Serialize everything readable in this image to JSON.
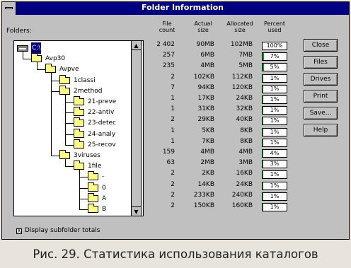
{
  "window": {
    "title": "Folder Information"
  },
  "folders_label": "Folders:",
  "columns": {
    "file_count": [
      "File",
      "count"
    ],
    "actual_size": [
      "Actual",
      "size"
    ],
    "allocated_size": [
      "Allocated",
      "size"
    ],
    "percent_used": [
      "Percent",
      "used"
    ]
  },
  "tree": [
    {
      "name": "C:\\",
      "type": "drive",
      "level": 0,
      "selected": true
    },
    {
      "name": "Avp30",
      "type": "folder",
      "level": 1
    },
    {
      "name": "Avpve",
      "type": "folder",
      "level": 2
    },
    {
      "name": "1classi",
      "type": "folder",
      "level": 3
    },
    {
      "name": "2method",
      "type": "folder",
      "level": 3
    },
    {
      "name": "21-preve",
      "type": "folder",
      "level": 4
    },
    {
      "name": "22-antiv",
      "type": "folder",
      "level": 4
    },
    {
      "name": "23-detec",
      "type": "folder",
      "level": 4
    },
    {
      "name": "24-analy",
      "type": "folder",
      "level": 4
    },
    {
      "name": "25-recov",
      "type": "folder",
      "level": 4
    },
    {
      "name": "3viruses",
      "type": "folder",
      "level": 3
    },
    {
      "name": "1file",
      "type": "folder",
      "level": 4
    },
    {
      "name": "-",
      "type": "folder",
      "level": 5
    },
    {
      "name": "0",
      "type": "folder",
      "level": 5
    },
    {
      "name": "A",
      "type": "folder",
      "level": 5
    },
    {
      "name": "B",
      "type": "folder",
      "level": 5
    }
  ],
  "rows": [
    {
      "count": "2 402",
      "actual": "90MB",
      "allocated": "102MB",
      "percent": "100%",
      "fill": 100
    },
    {
      "count": "257",
      "actual": "6MB",
      "allocated": "7MB",
      "percent": "7%",
      "fill": 7
    },
    {
      "count": "235",
      "actual": "4MB",
      "allocated": "5MB",
      "percent": "5%",
      "fill": 5
    },
    {
      "count": "2",
      "actual": "102KB",
      "allocated": "112KB",
      "percent": "1%",
      "fill": 1
    },
    {
      "count": "7",
      "actual": "94KB",
      "allocated": "120KB",
      "percent": "1%",
      "fill": 1
    },
    {
      "count": "1",
      "actual": "17KB",
      "allocated": "24KB",
      "percent": "1%",
      "fill": 1
    },
    {
      "count": "1",
      "actual": "31KB",
      "allocated": "32KB",
      "percent": "1%",
      "fill": 1
    },
    {
      "count": "2",
      "actual": "29KB",
      "allocated": "40KB",
      "percent": "1%",
      "fill": 1
    },
    {
      "count": "1",
      "actual": "5KB",
      "allocated": "8KB",
      "percent": "1%",
      "fill": 1
    },
    {
      "count": "1",
      "actual": "7KB",
      "allocated": "8KB",
      "percent": "1%",
      "fill": 1
    },
    {
      "count": "159",
      "actual": "4MB",
      "allocated": "4MB",
      "percent": "4%",
      "fill": 4
    },
    {
      "count": "63",
      "actual": "2MB",
      "allocated": "3MB",
      "percent": "3%",
      "fill": 3
    },
    {
      "count": "2",
      "actual": "2KB",
      "allocated": "16KB",
      "percent": "1%",
      "fill": 1
    },
    {
      "count": "2",
      "actual": "14KB",
      "allocated": "24KB",
      "percent": "1%",
      "fill": 1
    },
    {
      "count": "2",
      "actual": "233KB",
      "allocated": "240KB",
      "percent": "1%",
      "fill": 1
    },
    {
      "count": "2",
      "actual": "150KB",
      "allocated": "160KB",
      "percent": "1%",
      "fill": 1
    }
  ],
  "buttons": {
    "close": "Close",
    "files": "Files",
    "drives": "Drives",
    "print": "Print",
    "save": "Save...",
    "help": "Help"
  },
  "checkbox": {
    "label": "Display subfolder totals",
    "checked": true,
    "mark": "X"
  },
  "scroll_up": "▲",
  "scroll_down": "▼",
  "caption": "Рис. 29. Статистика использования каталогов",
  "colors": {
    "titlebar": "#000080",
    "window": "#c0c0c0",
    "bar_fill": "#00a000",
    "folder": "#ffff80"
  }
}
